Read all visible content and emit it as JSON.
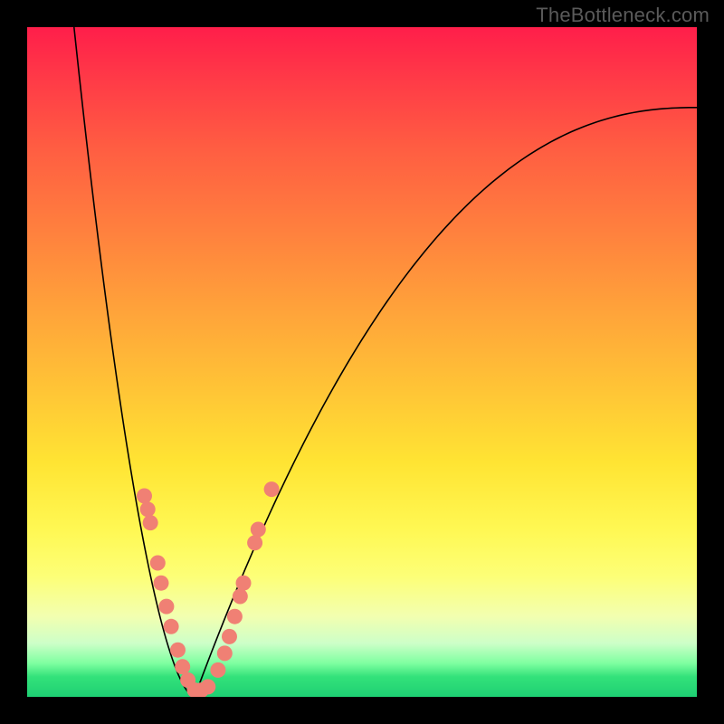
{
  "watermark": "TheBottleneck.com",
  "chart_data": {
    "type": "line",
    "title": "",
    "xlabel": "",
    "ylabel": "",
    "xlim": [
      0,
      100
    ],
    "ylim": [
      0,
      100
    ],
    "curve": {
      "description": "V-shaped bottleneck curve with minimum near x≈25",
      "vertex_x": 25,
      "left_branch": {
        "x_range": [
          7,
          25
        ],
        "y_start": 100,
        "y_end": 0
      },
      "right_branch": {
        "x_range": [
          25,
          100
        ],
        "y_start": 0,
        "y_end": 88
      }
    },
    "series": [
      {
        "name": "data-points",
        "color": "#f08074",
        "points": [
          {
            "x": 17.5,
            "y": 30
          },
          {
            "x": 18.0,
            "y": 28
          },
          {
            "x": 18.4,
            "y": 26
          },
          {
            "x": 19.5,
            "y": 20
          },
          {
            "x": 20.0,
            "y": 17
          },
          {
            "x": 20.8,
            "y": 13.5
          },
          {
            "x": 21.5,
            "y": 10.5
          },
          {
            "x": 22.5,
            "y": 7
          },
          {
            "x": 23.2,
            "y": 4.5
          },
          {
            "x": 24.0,
            "y": 2.5
          },
          {
            "x": 25.0,
            "y": 1
          },
          {
            "x": 26.0,
            "y": 1
          },
          {
            "x": 27.0,
            "y": 1.5
          },
          {
            "x": 28.5,
            "y": 4
          },
          {
            "x": 29.5,
            "y": 6.5
          },
          {
            "x": 30.2,
            "y": 9
          },
          {
            "x": 31.0,
            "y": 12
          },
          {
            "x": 31.8,
            "y": 15
          },
          {
            "x": 32.3,
            "y": 17
          },
          {
            "x": 34.0,
            "y": 23
          },
          {
            "x": 34.5,
            "y": 25
          },
          {
            "x": 36.5,
            "y": 31
          }
        ]
      }
    ],
    "background_gradient": {
      "top": "#ff1e4a",
      "mid": "#ffe433",
      "bottom": "#1ecf73"
    }
  }
}
